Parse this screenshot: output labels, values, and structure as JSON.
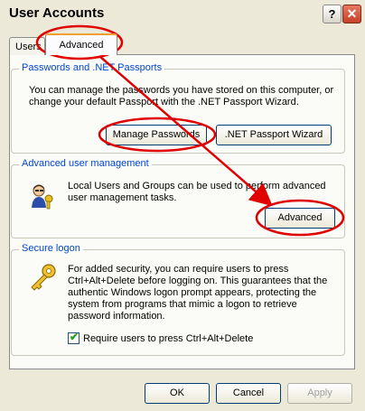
{
  "window": {
    "title": "User Accounts",
    "help_label": "?",
    "close_label": "✕"
  },
  "tabs": [
    {
      "label": "Users"
    },
    {
      "label": "Advanced"
    }
  ],
  "passwords": {
    "title": "Passwords and .NET Passports",
    "description": "You can manage the passwords you have stored on this computer, or change your default Passport with the .NET Passport Wizard.",
    "manage_button": "Manage Passwords",
    "wizard_button": ".NET Passport Wizard"
  },
  "advanced_mgmt": {
    "title": "Advanced user management",
    "description": "Local Users and Groups can be used to perform advanced user management tasks.",
    "button": "Advanced",
    "icon": "users-icon"
  },
  "secure_logon": {
    "title": "Secure logon",
    "description": "For added security, you can require users to press Ctrl+Alt+Delete before logging on. This guarantees that the authentic Windows logon prompt appears, protecting the system from programs that mimic a logon to retrieve password information.",
    "checkbox_label": "Require users to press Ctrl+Alt+Delete",
    "checked": true,
    "icon": "key-icon"
  },
  "footer": {
    "ok": "OK",
    "cancel": "Cancel",
    "apply": "Apply"
  },
  "colors": {
    "annotation": "#e00000",
    "group_title": "#0046d5"
  }
}
